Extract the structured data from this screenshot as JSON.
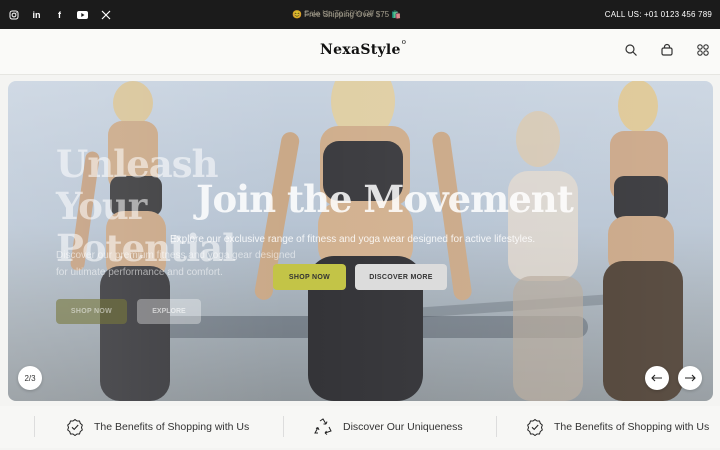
{
  "topbar": {
    "social": [
      {
        "icon": "instagram-icon"
      },
      {
        "icon": "linkedin-icon"
      },
      {
        "icon": "facebook-icon"
      },
      {
        "icon": "youtube-icon"
      },
      {
        "icon": "x-icon"
      }
    ],
    "announcement_a": "😊 Free Shipping Over $75 🛍️",
    "announcement_b": "Sale Up To 50% Off",
    "call_us": "CALL US: +01 0123 456 789"
  },
  "header": {
    "logo": "NexaStyle",
    "logo_mark": "o",
    "icons": [
      "search-icon",
      "bag-icon",
      "grid-menu-icon"
    ]
  },
  "hero": {
    "prev_slide": {
      "title": "Unleash Your Potential",
      "subtitle": "Discover our premium fitness and yoga gear designed for ultimate performance and comfort.",
      "primary_button": "SHOP NOW",
      "secondary_button": "EXPLORE"
    },
    "current_slide": {
      "title": "Join the Movement",
      "subtitle": "Explore our exclusive range of fitness and yoga wear designed for active lifestyles.",
      "primary_button": "SHOP NOW",
      "secondary_button": "DISCOVER MORE"
    },
    "pager": "2/3",
    "colors": {
      "accent": "#c3c447"
    }
  },
  "marquee": {
    "items": [
      {
        "icon": "badge-check-icon",
        "text": "The Benefits of Shopping with Us"
      },
      {
        "icon": "recycle-icon",
        "text": "Discover Our Uniqueness"
      },
      {
        "icon": "badge-check-icon",
        "text": "The Benefits of Shopping with Us"
      }
    ]
  }
}
